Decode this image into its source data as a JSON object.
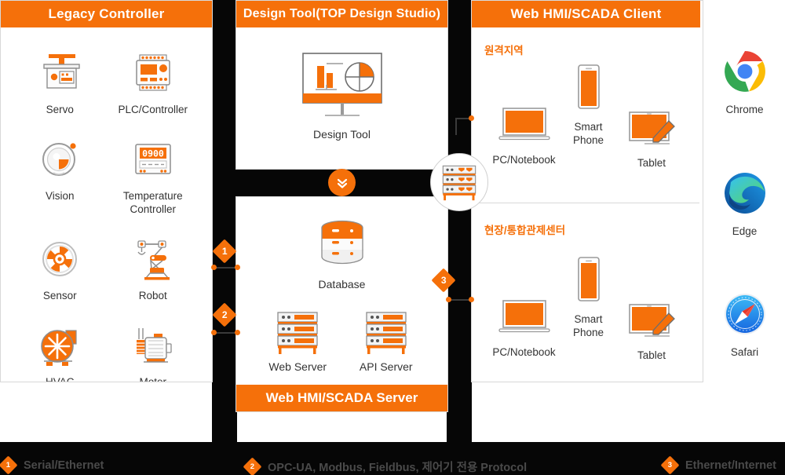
{
  "panels": {
    "legacy": {
      "title": "Legacy Controller",
      "devices": [
        {
          "label": "Servo",
          "icon": "servo-icon"
        },
        {
          "label": "PLC/Controller",
          "icon": "plc-controller-icon"
        },
        {
          "label": "Vision",
          "icon": "vision-camera-icon"
        },
        {
          "label": "Temperature\nController",
          "icon": "temperature-controller-icon",
          "display_value": "0900"
        },
        {
          "label": "Sensor",
          "icon": "sensor-icon"
        },
        {
          "label": "Robot",
          "icon": "robot-arm-icon"
        },
        {
          "label": "HVAC",
          "icon": "hvac-fan-icon"
        },
        {
          "label": "Moter",
          "icon": "motor-icon"
        }
      ]
    },
    "design": {
      "title": "Design Tool(TOP Design Studio)",
      "item_label": "Design Tool",
      "icon": "monitor-chart-icon",
      "chevron_icon": "chevrons-down-icon"
    },
    "server": {
      "footer_title": "Web HMI/SCADA Server",
      "items": [
        {
          "label": "Database",
          "icon": "database-icon"
        },
        {
          "label": "Web Server",
          "icon": "server-rack-icon"
        },
        {
          "label": "API Server",
          "icon": "server-rack-icon"
        }
      ]
    },
    "client": {
      "title": "Web HMI/SCADA Client",
      "sections": [
        {
          "label": "원격지역",
          "devices": [
            {
              "label": "PC/Notebook",
              "icon": "laptop-icon"
            },
            {
              "label": "Smart Phone",
              "icon": "smartphone-icon"
            },
            {
              "label": "Tablet",
              "icon": "tablet-pen-icon"
            }
          ]
        },
        {
          "label": "현장/통합관제센터",
          "devices": [
            {
              "label": "PC/Notebook",
              "icon": "laptop-icon"
            },
            {
              "label": "Smart Phone",
              "icon": "smartphone-icon"
            },
            {
              "label": "Tablet",
              "icon": "tablet-pen-icon"
            }
          ]
        }
      ]
    }
  },
  "browsers": [
    {
      "label": "Chrome",
      "icon": "chrome-logo-icon"
    },
    {
      "label": "Edge",
      "icon": "edge-logo-icon"
    },
    {
      "label": "Safari",
      "icon": "safari-logo-icon"
    }
  ],
  "central_node": {
    "icon": "server-rack-icon"
  },
  "connector_badges": [
    {
      "number": "1"
    },
    {
      "number": "2"
    },
    {
      "number": "3"
    }
  ],
  "legend": [
    {
      "number": "1",
      "text": "Serial/Ethernet"
    },
    {
      "number": "2",
      "text": "OPC-UA, Modbus, Fieldbus, 제어기 전용 Protocol"
    },
    {
      "number": "3",
      "text": "Ethernet/Internet"
    }
  ],
  "colors": {
    "accent": "#F5700A",
    "backdrop": "#060606",
    "panel_border": "#d8d8d8",
    "label_text": "#333333",
    "legend_text": "#4a4a4a"
  }
}
